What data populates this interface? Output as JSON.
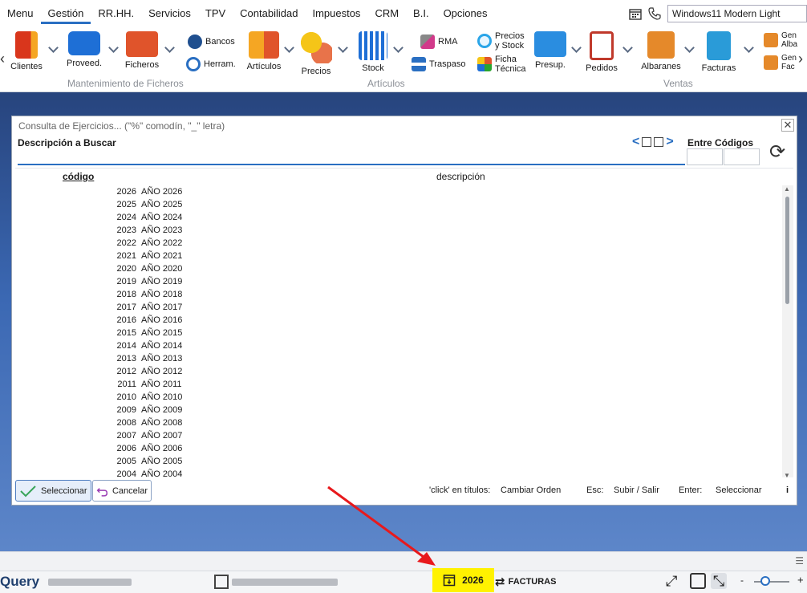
{
  "menu": {
    "items": [
      "Menu",
      "Gestión",
      "RR.HH.",
      "Servicios",
      "TPV",
      "Contabilidad",
      "Impuestos",
      "CRM",
      "B.I.",
      "Opciones"
    ],
    "active": "Gestión",
    "theme_value": "Windows11 Modern Light"
  },
  "ribbon": {
    "buttons": {
      "clientes": "Clientes",
      "proveed": "Proveed.",
      "ficheros": "Ficheros",
      "bancos": "Bancos",
      "herram": "Herram.",
      "articulos": "Artículos",
      "precios": "Precios",
      "stock": "Stock",
      "rma": "RMA",
      "traspaso": "Traspaso",
      "precios_stock_1": "Precios",
      "precios_stock_2": "y Stock",
      "ficha_1": "Ficha",
      "ficha_2": "Técnica",
      "presup": "Presup.",
      "pedidos": "Pedidos",
      "albaranes": "Albaranes",
      "facturas": "Facturas",
      "gen_alb_1": "Gen",
      "gen_alb_2": "Alba",
      "gen_fac_1": "Gen",
      "gen_fac_2": "Fac"
    },
    "groups": {
      "mantenimiento": "Mantenimiento de Ficheros",
      "articulos": "Artículos",
      "ventas": "Ventas"
    }
  },
  "dialog": {
    "title": "Consulta de Ejercicios...  (\"%\" comodín, \"_\" letra)",
    "search_label": "Descripción a Buscar",
    "search_value": "",
    "range_label": "Entre Códigos",
    "columns": {
      "code": "código",
      "description": "descripción"
    },
    "rows": [
      {
        "code": "2026",
        "desc": "AÑO 2026"
      },
      {
        "code": "2025",
        "desc": "AÑO 2025"
      },
      {
        "code": "2024",
        "desc": "AÑO 2024"
      },
      {
        "code": "2023",
        "desc": "AÑO 2023"
      },
      {
        "code": "2022",
        "desc": "AÑO 2022"
      },
      {
        "code": "2021",
        "desc": "AÑO 2021"
      },
      {
        "code": "2020",
        "desc": "AÑO 2020"
      },
      {
        "code": "2019",
        "desc": "AÑO 2019"
      },
      {
        "code": "2018",
        "desc": "AÑO 2018"
      },
      {
        "code": "2017",
        "desc": "AÑO 2017"
      },
      {
        "code": "2016",
        "desc": "AÑO 2016"
      },
      {
        "code": "2015",
        "desc": "AÑO 2015"
      },
      {
        "code": "2014",
        "desc": "AÑO 2014"
      },
      {
        "code": "2013",
        "desc": "AÑO 2013"
      },
      {
        "code": "2012",
        "desc": "AÑO 2012"
      },
      {
        "code": "2011",
        "desc": "AÑO 2011"
      },
      {
        "code": "2010",
        "desc": "AÑO 2010"
      },
      {
        "code": "2009",
        "desc": "AÑO 2009"
      },
      {
        "code": "2008",
        "desc": "AÑO 2008"
      },
      {
        "code": "2007",
        "desc": "AÑO 2007"
      },
      {
        "code": "2006",
        "desc": "AÑO 2006"
      },
      {
        "code": "2005",
        "desc": "AÑO 2005"
      },
      {
        "code": "2004",
        "desc": "AÑO 2004"
      }
    ],
    "select_label": "Seleccionar",
    "cancel_label": "Cancelar",
    "hints": {
      "click_key": "'click' en títulos:",
      "click_val": "Cambiar Orden",
      "esc_key": "Esc:",
      "esc_val": "Subir / Salir",
      "enter_key": "Enter:",
      "enter_val": "Seleccionar",
      "info": "i"
    }
  },
  "status": {
    "logo": "Query",
    "year": "2026",
    "document_type": "FACTURAS",
    "zoom_minus": "-",
    "zoom_plus": "+"
  },
  "colors": {
    "accent": "#2a6fc2",
    "highlight": "#fff200",
    "annotation_arrow": "#e8191c"
  }
}
